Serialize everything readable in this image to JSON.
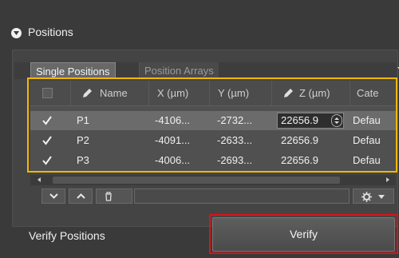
{
  "section": {
    "title": "Positions",
    "icon": "collapse-icon"
  },
  "tabs": [
    {
      "label": "Single Positions",
      "active": true
    },
    {
      "label": "Position Arrays",
      "active": false
    }
  ],
  "table": {
    "columns": {
      "name": "Name",
      "x": "X (µm)",
      "y": "Y (µm)",
      "z": "Z (µm)",
      "category": "Cate"
    },
    "rows": [
      {
        "checked": true,
        "name": "P1",
        "x": "-4106...",
        "y": "-2732...",
        "z": "22656.9",
        "category": "Defau",
        "selected": true
      },
      {
        "checked": true,
        "name": "P2",
        "x": "-4091...",
        "y": "-2633...",
        "z": "22656.9",
        "category": "Defau",
        "selected": false
      },
      {
        "checked": true,
        "name": "P3",
        "x": "-4006...",
        "y": "-2693...",
        "z": "22656.9",
        "category": "Defau",
        "selected": false
      }
    ]
  },
  "toolbar": {
    "move_down_icon": "chevron-down-icon",
    "move_up_icon": "chevron-up-icon",
    "delete_icon": "trash-icon",
    "settings_icon": "gear-icon"
  },
  "verify": {
    "label": "Verify Positions",
    "button": "Verify"
  },
  "colors": {
    "highlight_table": "#f2b705",
    "highlight_button": "#d7141a"
  }
}
